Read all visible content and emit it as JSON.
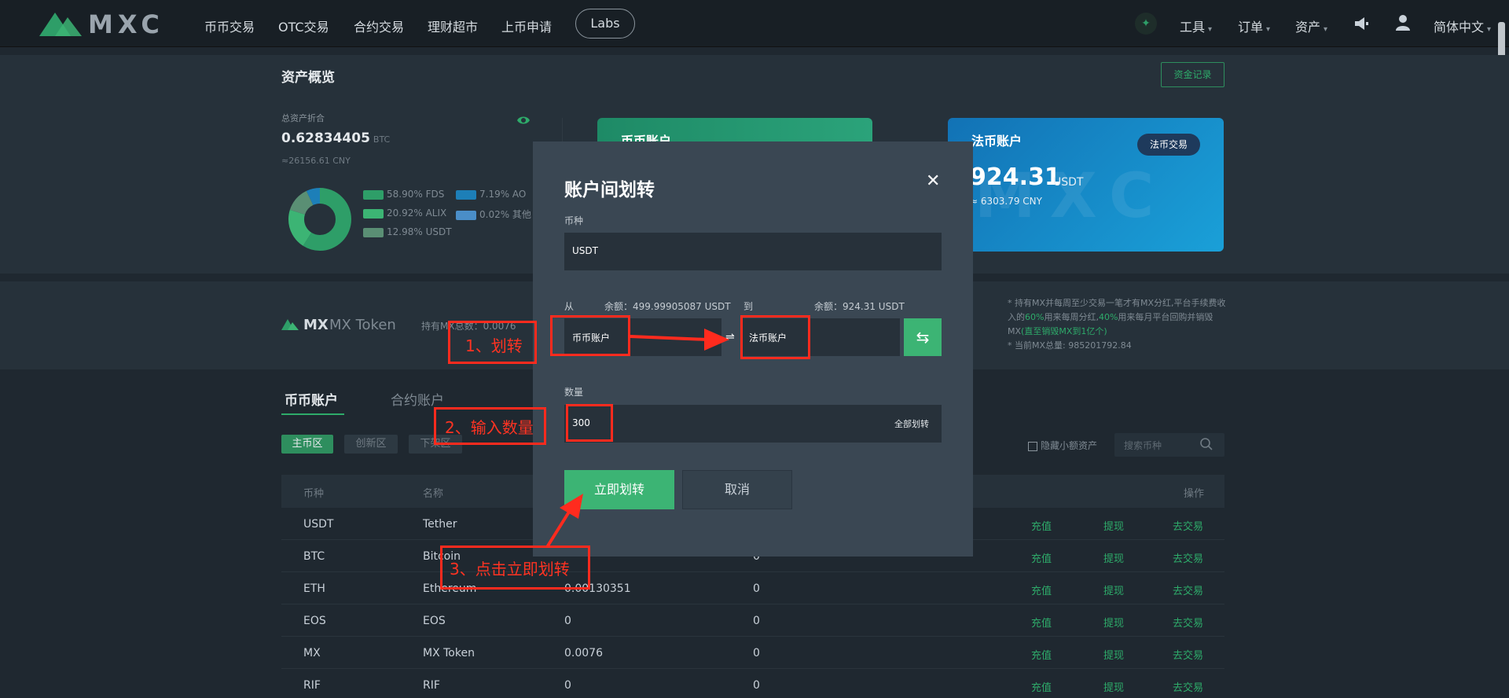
{
  "nav": {
    "logo_text": "MXC",
    "items": [
      "币币交易",
      "OTC交易",
      "合约交易",
      "理财超市",
      "上币申请"
    ],
    "labs": "Labs",
    "right": {
      "tools": "工具",
      "orders": "订单",
      "assets": "资产",
      "language": "简体中文"
    }
  },
  "overview": {
    "title": "资产概览",
    "record_button": "资金记录",
    "total_label": "总资产折合",
    "total_value": "0.62834405",
    "total_unit": "BTC",
    "total_cny": "≈26156.61 CNY",
    "legend": [
      {
        "label": "58.90% FDS",
        "color": "#2e9e68"
      },
      {
        "label": "7.19% AO",
        "color": "#1d7fb8"
      },
      {
        "label": "20.92% ALIX",
        "color": "#3cb474"
      },
      {
        "label": "0.02% 其他",
        "color": "#4a8ec8"
      },
      {
        "label": "12.98% USDT",
        "color": "#5a8f74"
      }
    ],
    "donut_shares": [
      58.9,
      20.92,
      12.98,
      7.19,
      0.02
    ],
    "coin_card_title": "币币账户",
    "fiat_card": {
      "title": "法币账户",
      "button": "法币交易",
      "value": "924.31",
      "unit": "USDT",
      "cny": "≈ 6303.79 CNY",
      "watermark": "MXC"
    }
  },
  "mx": {
    "symbol": "MX",
    "name": "MX Token",
    "hold": "持有MX总数：0.0076",
    "note_1": "* 持有MX并每周至少交易一笔才有MX分红,平台手续费收入的",
    "note_pct1": "60%",
    "note_2": "用来每周分红,",
    "note_pct2": "40%",
    "note_3": "用来每月平台回购并销毁MX",
    "note_link": "(直至销毁MX到1亿个)",
    "note_total": "* 当前MX总量: 985201792.84"
  },
  "accounts": {
    "tabs": [
      "币币账户",
      "合约账户"
    ],
    "chips": [
      "主币区",
      "创新区",
      "下架区"
    ],
    "hide_small": "隐藏小额资产",
    "search_placeholder": "搜索币种",
    "columns": [
      "币种",
      "名称",
      "操作"
    ],
    "actions": [
      "充值",
      "提现",
      "去交易"
    ],
    "rows": [
      {
        "symbol": "USDT",
        "name": "Tether",
        "available": "",
        "frozen": ""
      },
      {
        "symbol": "BTC",
        "name": "Bitcoin",
        "available": "",
        "frozen": "0"
      },
      {
        "symbol": "ETH",
        "name": "Ethereum",
        "available": "0.00130351",
        "frozen": "0"
      },
      {
        "symbol": "EOS",
        "name": "EOS",
        "available": "0",
        "frozen": "0"
      },
      {
        "symbol": "MX",
        "name": "MX Token",
        "available": "0.0076",
        "frozen": "0"
      },
      {
        "symbol": "RIF",
        "name": "RIF",
        "available": "0",
        "frozen": "0"
      }
    ]
  },
  "modal": {
    "title": "账户间划转",
    "coin_label": "币种",
    "coin_value": "USDT",
    "from_label": "从",
    "from_balance": "余额：499.99905087 USDT",
    "to_label": "到",
    "to_balance": "余额：924.31 USDT",
    "from_account": "币币账户",
    "to_account": "法币账户",
    "arrow_symbol": "⇌",
    "amount_label": "数量",
    "amount_value": "300",
    "all_transfer": "全部划转",
    "confirm": "立即划转",
    "cancel": "取消"
  },
  "annotations": {
    "step1": "1、划转",
    "step2": "2、输入数量",
    "step3": "3、点击立即划转"
  }
}
